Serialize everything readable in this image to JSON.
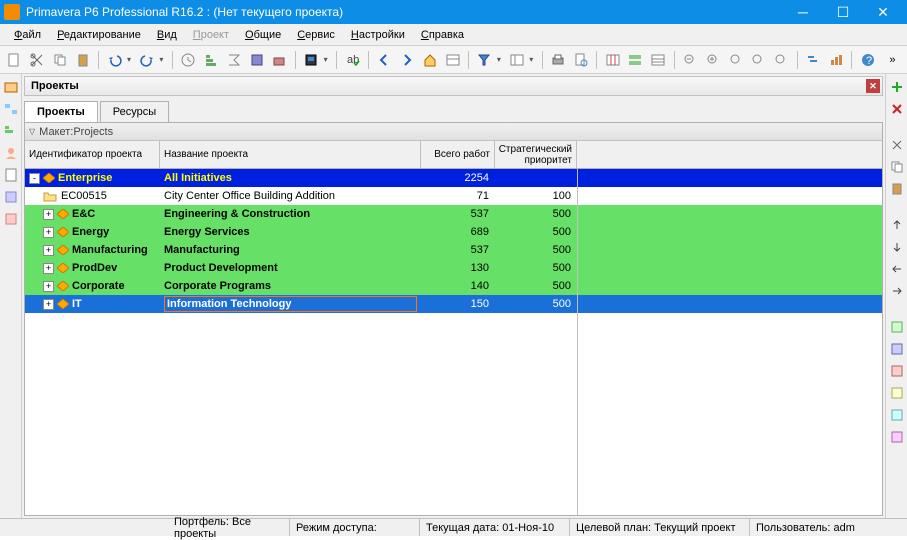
{
  "window": {
    "title": "Primavera P6 Professional R16.2 : (Нет текущего проекта)"
  },
  "menu": {
    "file": "Файл",
    "edit": "Редактирование",
    "view": "Вид",
    "project": "Проект",
    "common": "Общие",
    "service": "Сервис",
    "settings": "Настройки",
    "help": "Справка"
  },
  "panel": {
    "title": "Проекты",
    "tab_projects": "Проекты",
    "tab_resources": "Ресурсы",
    "layout_label": "Макет:Projects"
  },
  "columns": {
    "id": "Идентификатор проекта",
    "name": "Название проекта",
    "total": "Всего работ",
    "priority": "Стратегический приоритет"
  },
  "rows": [
    {
      "type": "root",
      "exp": "-",
      "id": "Enterprise",
      "name": "All Initiatives",
      "total": "2254",
      "prio": ""
    },
    {
      "type": "proj",
      "id": "EC00515",
      "name": "City Center Office Building Addition",
      "total": "71",
      "prio": "100"
    },
    {
      "type": "node",
      "exp": "+",
      "id": "E&C",
      "name": "Engineering & Construction",
      "total": "537",
      "prio": "500"
    },
    {
      "type": "node",
      "exp": "+",
      "id": "Energy",
      "name": "Energy Services",
      "total": "689",
      "prio": "500"
    },
    {
      "type": "node",
      "exp": "+",
      "id": "Manufacturing",
      "name": "Manufacturing",
      "total": "537",
      "prio": "500"
    },
    {
      "type": "node",
      "exp": "+",
      "id": "ProdDev",
      "name": "Product Development",
      "total": "130",
      "prio": "500"
    },
    {
      "type": "node",
      "exp": "+",
      "id": "Corporate",
      "name": "Corporate Programs",
      "total": "140",
      "prio": "500"
    },
    {
      "type": "sel",
      "exp": "+",
      "id": "IT",
      "name": "Information Technology",
      "total": "150",
      "prio": "500"
    }
  ],
  "status": {
    "portfolio": "Портфель: Все проекты",
    "access": "Режим доступа:",
    "date": "Текущая дата: 01-Ноя-10",
    "baseline": "Целевой план: Текущий проект",
    "user": "Пользователь: adm"
  }
}
